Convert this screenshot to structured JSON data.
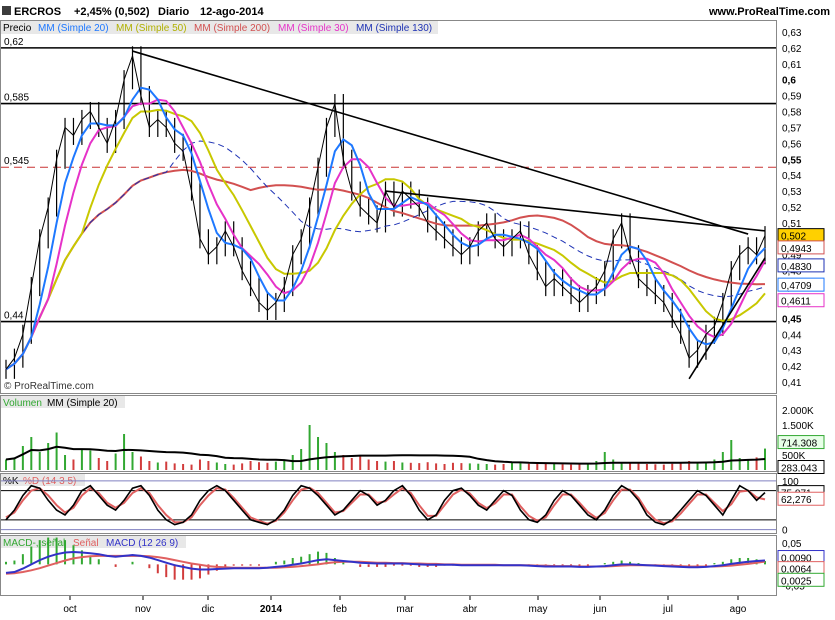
{
  "header": {
    "ticker": "ERCROS",
    "change": "+2,45% (0,502)",
    "period": "Diario",
    "date": "12-ago-2014",
    "site": "www.ProRealTime.com"
  },
  "watermark": "© ProRealTime.com",
  "colors": {
    "price": "#000000",
    "sma20": "#1e78ff",
    "sma50": "#c8c800",
    "sma200": "#d25050",
    "sma30": "#e632c8",
    "sma130": "#1e32b4",
    "vol_up": "#32a832",
    "vol_down": "#d23c3c",
    "k_line": "#000000",
    "d_line": "#e06060",
    "macd": "#3232c8",
    "signal": "#e06060",
    "hist": "#32a832"
  },
  "chart_data": [
    {
      "type": "line",
      "panel": "price",
      "legend": [
        "Precio",
        "MM (Simple 20)",
        "MM (Simple 50)",
        "MM (Simple 200)",
        "MM (Simple 30)",
        "MM (Simple 130)"
      ],
      "ylim": [
        0.405,
        0.635
      ],
      "yticks": [
        "0,63",
        "0,62",
        "0,61",
        "0,6",
        "0,59",
        "0,58",
        "0,57",
        "0,56",
        "0,55",
        "0,54",
        "0,53",
        "0,52",
        "0,51",
        "0,5",
        "0,49",
        "0,48",
        "0,47",
        "0,46",
        "0,45",
        "0,44",
        "0,43",
        "0,42",
        "0,41"
      ],
      "ytick_values": [
        0.63,
        0.62,
        0.61,
        0.6,
        0.59,
        0.58,
        0.57,
        0.56,
        0.55,
        0.54,
        0.53,
        0.52,
        0.51,
        0.5,
        0.49,
        0.48,
        0.47,
        0.46,
        0.45,
        0.44,
        0.43,
        0.42,
        0.41
      ],
      "xtick_labels": [
        "oct",
        "nov",
        "dic",
        "2014",
        "feb",
        "mar",
        "abr",
        "may",
        "jun",
        "jul",
        "ago"
      ],
      "level_labels": [
        {
          "text": "0,62",
          "value": 0.62
        },
        {
          "text": "0,585",
          "value": 0.585
        },
        {
          "text": "0,545",
          "value": 0.545
        },
        {
          "text": "0,44",
          "value": 0.448
        }
      ],
      "horizontal_levels": [
        0.62,
        0.585,
        0.545,
        0.448
      ],
      "dashed_level": 0.545,
      "last_values": [
        {
          "text": "0,502",
          "value": 0.502,
          "series": "price"
        },
        {
          "text": "0,4943",
          "value": 0.4943,
          "series": "sma200"
        },
        {
          "text": "0,4830",
          "value": 0.483,
          "series": "sma130"
        },
        {
          "text": "0,4709",
          "value": 0.4709,
          "series": "sma20"
        },
        {
          "text": "0,4611",
          "value": 0.4611,
          "series": "sma30"
        }
      ],
      "close": [
        0.418,
        0.425,
        0.44,
        0.47,
        0.5,
        0.52,
        0.55,
        0.57,
        0.565,
        0.575,
        0.58,
        0.57,
        0.56,
        0.575,
        0.6,
        0.615,
        0.59,
        0.57,
        0.575,
        0.57,
        0.56,
        0.555,
        0.53,
        0.5,
        0.49,
        0.495,
        0.505,
        0.495,
        0.48,
        0.47,
        0.46,
        0.455,
        0.46,
        0.47,
        0.49,
        0.5,
        0.52,
        0.545,
        0.57,
        0.585,
        0.55,
        0.53,
        0.52,
        0.515,
        0.51,
        0.53,
        0.52,
        0.53,
        0.525,
        0.52,
        0.51,
        0.505,
        0.5,
        0.495,
        0.49,
        0.495,
        0.505,
        0.51,
        0.5,
        0.495,
        0.5,
        0.505,
        0.49,
        0.48,
        0.47,
        0.475,
        0.47,
        0.465,
        0.46,
        0.465,
        0.47,
        0.48,
        0.5,
        0.51,
        0.49,
        0.475,
        0.47,
        0.465,
        0.46,
        0.45,
        0.44,
        0.425,
        0.43,
        0.44,
        0.445,
        0.46,
        0.48,
        0.49,
        0.495,
        0.49,
        0.502
      ]
    },
    {
      "type": "bar",
      "panel": "volume",
      "legend": [
        "Volumen",
        "MM (Simple 20)"
      ],
      "yticks": [
        "2.000K",
        "1.500K",
        "1.000K",
        "500K"
      ],
      "ytick_values": [
        2000,
        1500,
        1000,
        500
      ],
      "ylim": [
        0,
        2400
      ],
      "last_values": [
        {
          "text": "714.308",
          "value": 714.308
        },
        {
          "text": "283.043",
          "value": 283.043
        }
      ],
      "values": [
        350,
        420,
        800,
        1100,
        600,
        900,
        1250,
        500,
        350,
        700,
        650,
        400,
        300,
        550,
        1200,
        600,
        450,
        300,
        250,
        280,
        220,
        200,
        180,
        350,
        300,
        250,
        200,
        180,
        220,
        300,
        260,
        240,
        280,
        350,
        500,
        700,
        1500,
        1100,
        900,
        600,
        500,
        400,
        450,
        350,
        300,
        280,
        300,
        250,
        240,
        230,
        260,
        220,
        200,
        240,
        230,
        220,
        210,
        200,
        180,
        200,
        250,
        230,
        210,
        220,
        200,
        210,
        190,
        180,
        200,
        220,
        300,
        600,
        350,
        250,
        230,
        220,
        200,
        190,
        180,
        210,
        260,
        300,
        250,
        240,
        350,
        600,
        1000,
        400,
        350,
        420,
        714
      ]
    },
    {
      "type": "line",
      "panel": "stochastic",
      "legend": [
        "%K",
        "%D (14 3 5)"
      ],
      "yticks": [
        "100",
        "0"
      ],
      "ytick_values": [
        100,
        0
      ],
      "ylim": [
        -5,
        110
      ],
      "levels": [
        80,
        20
      ],
      "last_values": [
        {
          "text": "75,871",
          "value": 75.871
        },
        {
          "text": "62,276",
          "value": 62.276
        }
      ],
      "k": [
        20,
        40,
        70,
        90,
        85,
        60,
        40,
        30,
        50,
        80,
        90,
        70,
        50,
        40,
        60,
        85,
        90,
        70,
        40,
        20,
        10,
        15,
        30,
        60,
        80,
        90,
        80,
        60,
        40,
        20,
        15,
        10,
        20,
        40,
        70,
        90,
        85,
        70,
        50,
        30,
        40,
        60,
        80,
        70,
        50,
        60,
        80,
        90,
        70,
        40,
        20,
        30,
        60,
        80,
        85,
        70,
        50,
        40,
        60,
        80,
        70,
        40,
        20,
        15,
        30,
        60,
        80,
        70,
        50,
        30,
        20,
        40,
        70,
        90,
        80,
        60,
        30,
        15,
        10,
        20,
        40,
        60,
        80,
        70,
        50,
        30,
        60,
        90,
        80,
        60,
        76
      ],
      "d": [
        25,
        35,
        60,
        80,
        85,
        70,
        50,
        35,
        45,
        70,
        85,
        75,
        55,
        45,
        55,
        75,
        85,
        75,
        50,
        30,
        15,
        15,
        25,
        50,
        70,
        85,
        82,
        65,
        45,
        25,
        18,
        12,
        18,
        35,
        60,
        82,
        86,
        75,
        55,
        35,
        38,
        55,
        72,
        72,
        55,
        58,
        72,
        85,
        75,
        50,
        28,
        28,
        50,
        72,
        82,
        74,
        55,
        44,
        54,
        72,
        72,
        48,
        28,
        18,
        25,
        50,
        72,
        72,
        55,
        36,
        24,
        34,
        60,
        82,
        82,
        65,
        38,
        20,
        13,
        17,
        33,
        53,
        72,
        72,
        55,
        38,
        52,
        78,
        80,
        66,
        62
      ]
    },
    {
      "type": "line",
      "panel": "macd",
      "legend": [
        "MACD-, señal",
        "Señal",
        "MACD (12 26 9)"
      ],
      "yticks": [
        "0,05",
        "0",
        "-0,05"
      ],
      "ytick_values": [
        0.05,
        0,
        -0.05
      ],
      "ylim": [
        -0.065,
        0.062
      ],
      "last_values": [
        {
          "text": "0,0090",
          "value": 0.009
        },
        {
          "text": "0,0064",
          "value": 0.0064
        },
        {
          "text": "0,0025",
          "value": 0.0025
        }
      ],
      "macd": [
        -0.02,
        -0.018,
        -0.01,
        0.0,
        0.01,
        0.018,
        0.024,
        0.028,
        0.029,
        0.028,
        0.026,
        0.024,
        0.02,
        0.018,
        0.02,
        0.022,
        0.02,
        0.016,
        0.01,
        0.004,
        -0.002,
        -0.006,
        -0.01,
        -0.012,
        -0.012,
        -0.011,
        -0.01,
        -0.009,
        -0.009,
        -0.009,
        -0.009,
        -0.008,
        -0.006,
        -0.004,
        -0.001,
        0.002,
        0.006,
        0.01,
        0.012,
        0.01,
        0.008,
        0.006,
        0.004,
        0.003,
        0.002,
        0.002,
        0.002,
        0.002,
        0.001,
        0.0,
        -0.001,
        -0.001,
        -0.001,
        -0.001,
        -0.002,
        -0.002,
        -0.002,
        -0.002,
        -0.002,
        -0.002,
        -0.002,
        -0.002,
        -0.003,
        -0.004,
        -0.005,
        -0.005,
        -0.005,
        -0.005,
        -0.006,
        -0.006,
        -0.005,
        -0.004,
        -0.002,
        0.0,
        0.0,
        -0.001,
        -0.002,
        -0.003,
        -0.004,
        -0.005,
        -0.006,
        -0.007,
        -0.007,
        -0.006,
        -0.004,
        -0.002,
        0.001,
        0.004,
        0.006,
        0.008,
        0.009
      ],
      "signal": [
        -0.022,
        -0.021,
        -0.018,
        -0.014,
        -0.009,
        -0.003,
        0.003,
        0.009,
        0.014,
        0.017,
        0.019,
        0.02,
        0.02,
        0.02,
        0.02,
        0.02,
        0.02,
        0.019,
        0.017,
        0.014,
        0.01,
        0.006,
        0.002,
        -0.001,
        -0.004,
        -0.006,
        -0.007,
        -0.008,
        -0.008,
        -0.008,
        -0.008,
        -0.008,
        -0.008,
        -0.007,
        -0.006,
        -0.004,
        -0.002,
        0.0,
        0.003,
        0.005,
        0.006,
        0.006,
        0.006,
        0.005,
        0.004,
        0.004,
        0.003,
        0.003,
        0.002,
        0.002,
        0.001,
        0.001,
        0.0,
        0.0,
        -0.001,
        -0.001,
        -0.001,
        -0.001,
        -0.001,
        -0.002,
        -0.002,
        -0.002,
        -0.002,
        -0.003,
        -0.003,
        -0.004,
        -0.004,
        -0.004,
        -0.005,
        -0.005,
        -0.005,
        -0.005,
        -0.004,
        -0.003,
        -0.002,
        -0.002,
        -0.002,
        -0.002,
        -0.003,
        -0.003,
        -0.004,
        -0.005,
        -0.005,
        -0.005,
        -0.005,
        -0.004,
        -0.003,
        -0.001,
        0.001,
        0.004,
        0.0064
      ]
    }
  ]
}
